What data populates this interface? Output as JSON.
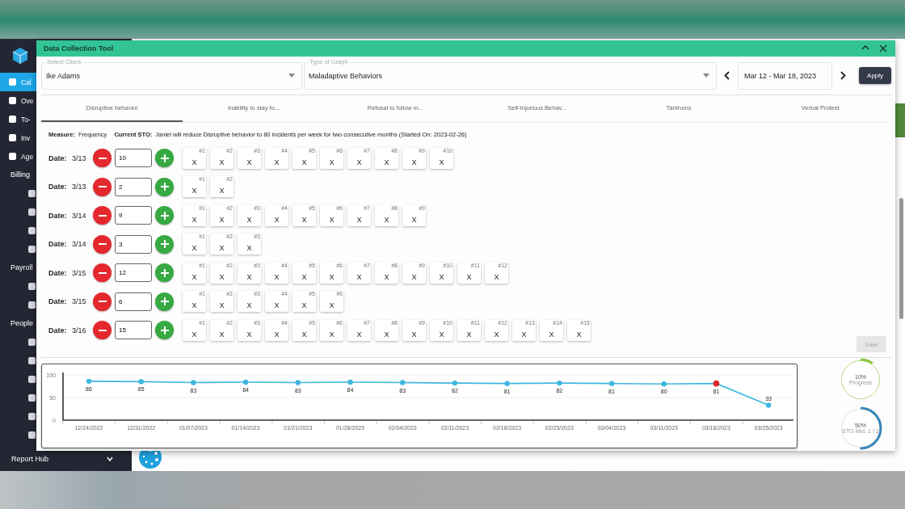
{
  "sidebar": {
    "items": [
      {
        "kind": "link",
        "label": "Cal",
        "selected": true
      },
      {
        "kind": "link",
        "label": "Ove",
        "selected": false
      },
      {
        "kind": "link",
        "label": "To-",
        "selected": false
      },
      {
        "kind": "link",
        "label": "Inv",
        "selected": false
      },
      {
        "kind": "link",
        "label": "Age",
        "selected": false
      },
      {
        "kind": "section",
        "label": "Billing"
      },
      {
        "kind": "icon"
      },
      {
        "kind": "icon"
      },
      {
        "kind": "icon"
      },
      {
        "kind": "icon"
      },
      {
        "kind": "section",
        "label": "Payroll"
      },
      {
        "kind": "icon"
      },
      {
        "kind": "icon"
      },
      {
        "kind": "section",
        "label": "People"
      },
      {
        "kind": "icon"
      },
      {
        "kind": "icon"
      },
      {
        "kind": "icon"
      },
      {
        "kind": "icon"
      },
      {
        "kind": "icon"
      },
      {
        "kind": "icon"
      }
    ],
    "footer": {
      "label": "Report Hub",
      "expanded": false
    }
  },
  "window": {
    "title": "Data Collection Tool"
  },
  "filters": {
    "client": {
      "label": "Select Client",
      "value": "Ike Adams"
    },
    "graph_type": {
      "label": "Type of Graph",
      "value": "Maladaptive Behaviors"
    },
    "date_range": "Mar 12 - Mar 18, 2023",
    "apply": "Apply"
  },
  "tabs": [
    {
      "label": "Disruptive behavior",
      "selected": true
    },
    {
      "label": "Inability to stay fo...",
      "selected": false
    },
    {
      "label": "Refusal to follow in...",
      "selected": false
    },
    {
      "label": "Self-Injurious Behav...",
      "selected": false
    },
    {
      "label": "Tantrums",
      "selected": false
    },
    {
      "label": "Verbal Protest",
      "selected": false
    }
  ],
  "measure": {
    "label": "Measure:",
    "value": "Frequency",
    "sto_label": "Current STO:",
    "sto_text": "Janiel will reduce Disruptive behavior to 80 incidents per week for two consecutive months (Started On: 2023-02-26)"
  },
  "rows": [
    {
      "date_label": "Date:",
      "date": "3/13",
      "value": "10",
      "tallies": [
        {
          "n": "#1",
          "mark": "X"
        },
        {
          "n": "#2",
          "mark": "X"
        },
        {
          "n": "#3",
          "mark": "X"
        },
        {
          "n": "#4",
          "mark": "X"
        },
        {
          "n": "#5",
          "mark": "X"
        },
        {
          "n": "#6",
          "mark": "X"
        },
        {
          "n": "#7",
          "mark": "X"
        },
        {
          "n": "#8",
          "mark": "X"
        },
        {
          "n": "#9",
          "mark": "X"
        },
        {
          "n": "#10",
          "mark": "X"
        }
      ]
    },
    {
      "date_label": "Date:",
      "date": "3/13",
      "value": "2",
      "tallies": [
        {
          "n": "#1",
          "mark": "X"
        },
        {
          "n": "#2",
          "mark": "X"
        }
      ]
    },
    {
      "date_label": "Date:",
      "date": "3/14",
      "value": "9",
      "tallies": [
        {
          "n": "#1",
          "mark": "X"
        },
        {
          "n": "#2",
          "mark": "X"
        },
        {
          "n": "#3",
          "mark": "X"
        },
        {
          "n": "#4",
          "mark": "X"
        },
        {
          "n": "#5",
          "mark": "X"
        },
        {
          "n": "#6",
          "mark": "X"
        },
        {
          "n": "#7",
          "mark": "X"
        },
        {
          "n": "#8",
          "mark": "X"
        },
        {
          "n": "#9",
          "mark": "X"
        }
      ]
    },
    {
      "date_label": "Date:",
      "date": "3/14",
      "value": "3",
      "tallies": [
        {
          "n": "#1",
          "mark": "X"
        },
        {
          "n": "#2",
          "mark": "X"
        },
        {
          "n": "#3",
          "mark": "X"
        }
      ]
    },
    {
      "date_label": "Date:",
      "date": "3/15",
      "value": "12",
      "tallies": [
        {
          "n": "#1",
          "mark": "X"
        },
        {
          "n": "#2",
          "mark": "X"
        },
        {
          "n": "#3",
          "mark": "X"
        },
        {
          "n": "#4",
          "mark": "X"
        },
        {
          "n": "#5",
          "mark": "X"
        },
        {
          "n": "#6",
          "mark": "X"
        },
        {
          "n": "#7",
          "mark": "X"
        },
        {
          "n": "#8",
          "mark": "X"
        },
        {
          "n": "#9",
          "mark": "X"
        },
        {
          "n": "#10",
          "mark": "X"
        },
        {
          "n": "#11",
          "mark": "X"
        },
        {
          "n": "#12",
          "mark": "X"
        }
      ]
    },
    {
      "date_label": "Date:",
      "date": "3/15",
      "value": "6",
      "tallies": [
        {
          "n": "#1",
          "mark": "X"
        },
        {
          "n": "#2",
          "mark": "X"
        },
        {
          "n": "#3",
          "mark": "X"
        },
        {
          "n": "#4",
          "mark": "X"
        },
        {
          "n": "#5",
          "mark": "X"
        },
        {
          "n": "#6",
          "mark": "X"
        }
      ]
    },
    {
      "date_label": "Date:",
      "date": "3/16",
      "value": "15",
      "tallies": [
        {
          "n": "#1",
          "mark": "X"
        },
        {
          "n": "#2",
          "mark": "X"
        },
        {
          "n": "#3",
          "mark": "X"
        },
        {
          "n": "#4",
          "mark": "X"
        },
        {
          "n": "#5",
          "mark": "X"
        },
        {
          "n": "#6",
          "mark": "X"
        },
        {
          "n": "#7",
          "mark": "X"
        },
        {
          "n": "#8",
          "mark": "X"
        },
        {
          "n": "#9",
          "mark": "X"
        },
        {
          "n": "#10",
          "mark": "X"
        },
        {
          "n": "#11",
          "mark": "X"
        },
        {
          "n": "#12",
          "mark": "X"
        },
        {
          "n": "#13",
          "mark": "X"
        },
        {
          "n": "#14",
          "mark": "X"
        },
        {
          "n": "#15",
          "mark": "X"
        }
      ]
    }
  ],
  "save": {
    "label": "Save",
    "disabled": true
  },
  "chart_data": {
    "type": "line",
    "categories": [
      "12/24/2022",
      "12/31/2022",
      "01/07/2023",
      "01/14/2023",
      "01/21/2023",
      "01/28/2023",
      "02/04/2023",
      "02/11/2023",
      "02/18/2023",
      "02/25/2023",
      "03/04/2023",
      "03/11/2023",
      "03/18/2023",
      "03/25/2023"
    ],
    "series": [
      {
        "color": "#3fb6e0",
        "marker": "circle",
        "values": [
          86,
          85,
          83,
          84,
          83,
          84,
          83,
          82,
          81,
          82,
          81,
          80,
          81,
          33
        ],
        "value_labels": [
          "86",
          "85",
          "83",
          "84",
          "83",
          "84",
          "83",
          "82",
          "81",
          "82",
          "81",
          "80",
          null,
          "33"
        ]
      },
      {
        "color": "#e02828",
        "marker": "circle",
        "values": [
          null,
          null,
          null,
          null,
          null,
          null,
          null,
          null,
          null,
          null,
          null,
          null,
          81,
          null
        ],
        "value_labels": [
          null,
          null,
          null,
          null,
          null,
          null,
          null,
          null,
          null,
          null,
          null,
          null,
          "81",
          null
        ]
      }
    ],
    "ylim": [
      0,
      100
    ],
    "yticks": [
      0,
      50,
      100
    ],
    "data_labels": "value_labels"
  },
  "gauges": [
    {
      "value": "10%",
      "label": "Progress",
      "level": 0.1,
      "color": "#8cc63f"
    },
    {
      "value": "50%",
      "label": "STO Met: 1 / 2",
      "level": 0.5,
      "color": "#3a88b8"
    }
  ]
}
